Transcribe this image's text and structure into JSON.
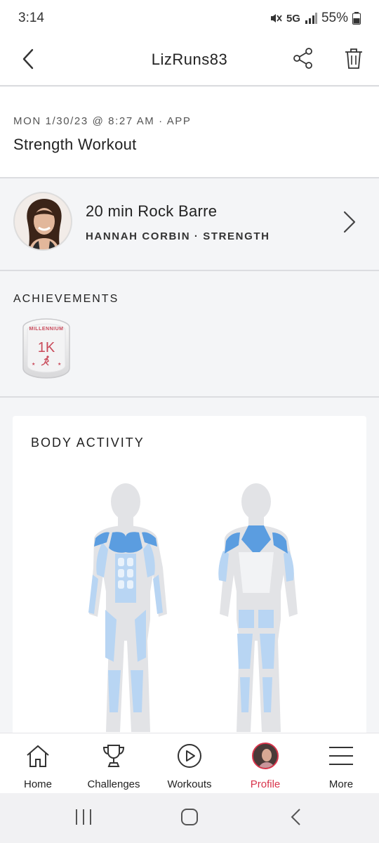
{
  "status": {
    "time": "3:14",
    "network": "5G",
    "battery": "55%"
  },
  "header": {
    "title": "LizRuns83"
  },
  "workout": {
    "meta": "MON 1/30/23 @ 8:27 AM · APP",
    "name": "Strength Workout"
  },
  "class": {
    "title": "20 min Rock Barre",
    "subtitle": "HANNAH CORBIN · STRENGTH"
  },
  "achievements": {
    "heading": "ACHIEVEMENTS",
    "badge": {
      "arc": "MILLENNIUM",
      "value": "1K"
    }
  },
  "body_activity": {
    "heading": "BODY ACTIVITY",
    "colors": {
      "active": "#5b9de0",
      "light": "#b8d5f3",
      "body": "#e2e3e6"
    }
  },
  "tabs": [
    {
      "label": "Home",
      "icon": "home-icon"
    },
    {
      "label": "Challenges",
      "icon": "trophy-icon"
    },
    {
      "label": "Workouts",
      "icon": "play-icon"
    },
    {
      "label": "Profile",
      "icon": "profile-avatar",
      "active": true
    },
    {
      "label": "More",
      "icon": "menu-icon"
    }
  ],
  "accent": "#d8344b"
}
